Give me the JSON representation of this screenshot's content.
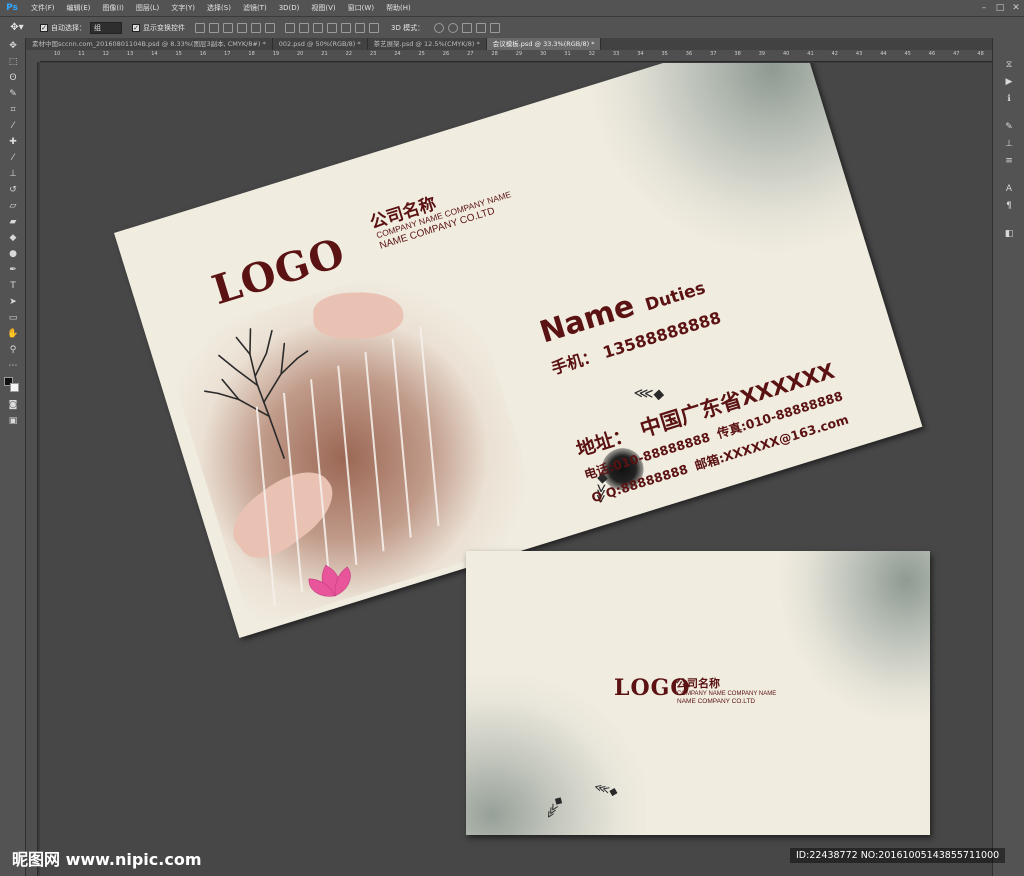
{
  "app": {
    "logo": "Ps"
  },
  "menu": [
    "文件(F)",
    "编辑(E)",
    "图像(I)",
    "图层(L)",
    "文字(Y)",
    "选择(S)",
    "滤镜(T)",
    "3D(D)",
    "视图(V)",
    "窗口(W)",
    "帮助(H)"
  ],
  "options": {
    "auto_select_label": "自动选择：",
    "auto_select_value": "组",
    "show_transform_label": "显示变换控件",
    "mode_3d_label": "3D 模式："
  },
  "tabs": [
    {
      "label": "素材中国sccnn.com_20160801104B.psd @ 8.33%(图层3副本, CMYK/8#) *",
      "active": false
    },
    {
      "label": "002.psd @ 50%(RGB/8) *",
      "active": false
    },
    {
      "label": "茶艺展架.psd @ 12.5%(CMYK/8) *",
      "active": false
    },
    {
      "label": "会议模板.psd @ 33.3%(RGB/8) *",
      "active": true
    }
  ],
  "ruler_marks": [
    "10",
    "11",
    "12",
    "13",
    "14",
    "15",
    "16",
    "17",
    "18",
    "19",
    "20",
    "21",
    "22",
    "23",
    "24",
    "25",
    "26",
    "27",
    "28",
    "29",
    "30",
    "31",
    "32",
    "33",
    "34",
    "35",
    "36",
    "37",
    "38",
    "39",
    "40",
    "41",
    "42",
    "43",
    "44",
    "45",
    "46",
    "47",
    "48"
  ],
  "card_front": {
    "logo": "LOGO",
    "company_cn": "公司名称",
    "company_en_1": "COMPANY NAME COMPANY NAME",
    "company_en_2": "NAME COMPANY CO.LTD",
    "name": "Name",
    "duties": "Duties",
    "mobile_label": "手机：",
    "mobile": "13588888888",
    "address_label": "地址：",
    "address": "中国广东省XXXXXX",
    "phone": "电话:010-88888888",
    "fax": "传真:010-88888888",
    "qq": "Q Q:88888888",
    "email": "邮箱:XXXXXX@163.com"
  },
  "card_back": {
    "logo": "LOGO",
    "company_cn": "公司名称",
    "company_en_1": "COMPANY NAME COMPANY NAME",
    "company_en_2": "NAME COMPANY CO.LTD"
  },
  "watermark": {
    "site": "昵图网 www.nipic.com",
    "id": "ID:22438772 NO:20161005143855711000"
  },
  "colors": {
    "brand_dark_red": "#5a1212",
    "card_bg": "#f1ece0",
    "ps_blue": "#31a8ff"
  }
}
